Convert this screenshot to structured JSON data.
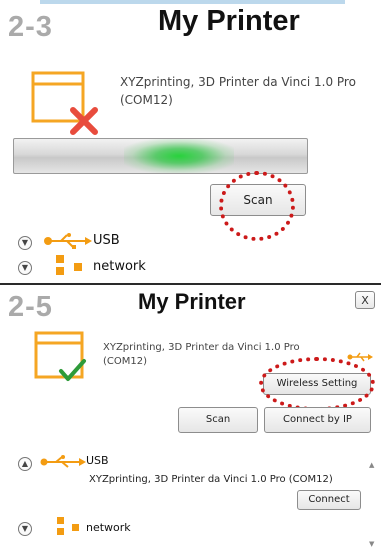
{
  "top": {
    "step": "2-3",
    "title": "My Printer",
    "printer_name_line1": "XYZprinting, 3D Printer da Vinci 1.0 Pro",
    "printer_name_line2": "(COM12)",
    "scan_label": "Scan",
    "usb_label": "USB",
    "network_label": "network",
    "scan_progress_state": "searching"
  },
  "bottom": {
    "step": "2-5",
    "title": "My Printer",
    "close_label": "X",
    "printer_name_line1": "XYZprinting, 3D Printer da Vinci 1.0 Pro",
    "printer_name_line2": "(COM12)",
    "wireless_setting_label": "Wireless Setting",
    "scan_label": "Scan",
    "connect_by_ip_label": "Connect by IP",
    "usb_label": "USB",
    "usb_device": "XYZprinting, 3D Printer da Vinci 1.0 Pro (COM12)",
    "connect_label": "Connect",
    "network_label": "network"
  },
  "colors": {
    "printer_icon": "#f5a623",
    "error_x": "#e84c3d",
    "ok_check": "#2e9b3a",
    "usb": "#f39c12",
    "highlight_dots": "#cc1a1a",
    "progress_glow": "#28d23c"
  },
  "icons": {
    "printer": "printer-icon",
    "error": "x-mark-icon",
    "ok": "checkmark-icon",
    "usb": "usb-icon",
    "network": "network-icon",
    "expand": "chevron-down-icon",
    "collapse": "chevron-up-icon"
  }
}
